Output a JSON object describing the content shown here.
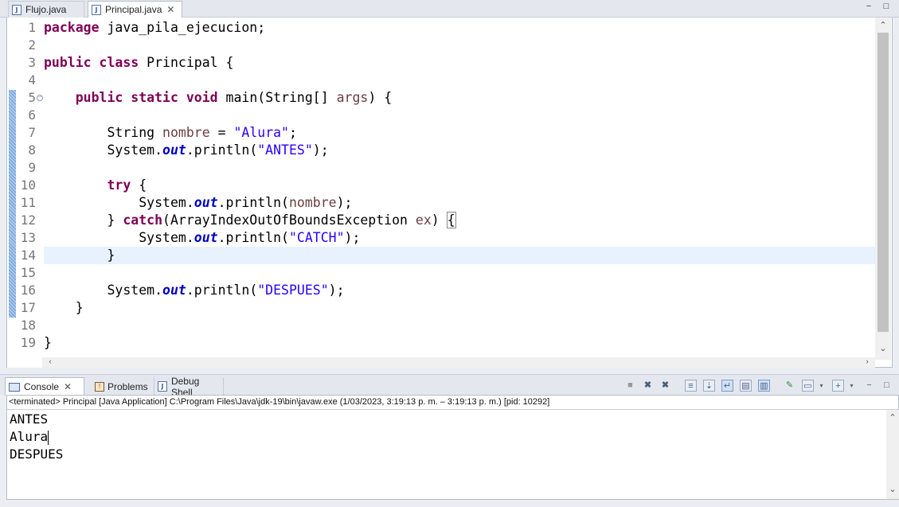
{
  "editor_tabs": [
    {
      "label": "Flujo.java",
      "icon": "java-file-icon",
      "active": false
    },
    {
      "label": "Principal.java",
      "icon": "java-file-icon",
      "active": true
    }
  ],
  "editor": {
    "line_numbers": [
      "1",
      "2",
      "3",
      "4",
      "5",
      "6",
      "7",
      "8",
      "9",
      "10",
      "11",
      "12",
      "13",
      "14",
      "15",
      "16",
      "17",
      "18",
      "19"
    ],
    "current_line": 14,
    "code": {
      "l1_kw": "package",
      "l1_rest": " java_pila_ejecucion;",
      "l3_kw1": "public",
      "l3_kw2": "class",
      "l3_rest": " Principal {",
      "l5_kw1": "public",
      "l5_kw2": "static",
      "l5_kw3": "void",
      "l5_a": " main(String[] ",
      "l5_var": "args",
      "l5_b": ") {",
      "l7_a": "String ",
      "l7_var": "nombre",
      "l7_b": " = ",
      "l7_str": "\"Alura\"",
      "l7_c": ";",
      "l8_a": "System.",
      "l8_fld": "out",
      "l8_b": ".println(",
      "l8_str": "\"ANTES\"",
      "l8_c": ");",
      "l10_kw": "try",
      "l10_rest": " {",
      "l11_a": "System.",
      "l11_fld": "out",
      "l11_b": ".println(",
      "l11_var": "nombre",
      "l11_c": ");",
      "l12_a": "} ",
      "l12_kw": "catch",
      "l12_b": "(ArrayIndexOutOfBoundsException ",
      "l12_var": "ex",
      "l12_c": ") ",
      "l12_br": "{",
      "l13_a": "System.",
      "l13_fld": "out",
      "l13_b": ".println(",
      "l13_str": "\"CATCH\"",
      "l13_c": ");",
      "l14": "}",
      "l16_a": "System.",
      "l16_fld": "out",
      "l16_b": ".println(",
      "l16_str": "\"DESPUES\"",
      "l16_c": ");",
      "l17": "}",
      "l19": "}"
    }
  },
  "console_tabs": [
    {
      "label": "Console",
      "icon": "console-icon",
      "active": true
    },
    {
      "label": "Problems",
      "icon": "problems-icon",
      "active": false
    },
    {
      "label": "Debug Shell",
      "icon": "debug-shell-icon",
      "active": false
    }
  ],
  "console": {
    "status": "<terminated> Principal [Java Application] C:\\Program Files\\Java\\jdk-19\\bin\\javaw.exe  (1/03/2023, 3:19:13 p. m. – 3:19:13 p. m.) [pid: 10292]",
    "output": [
      "ANTES",
      "Alura",
      "DESPUES"
    ]
  },
  "colors": {
    "keyword": "#7f0055",
    "string": "#2a00ff",
    "variable": "#6a3e3e",
    "field": "#0000c0",
    "current_line": "#e8f2fe"
  }
}
